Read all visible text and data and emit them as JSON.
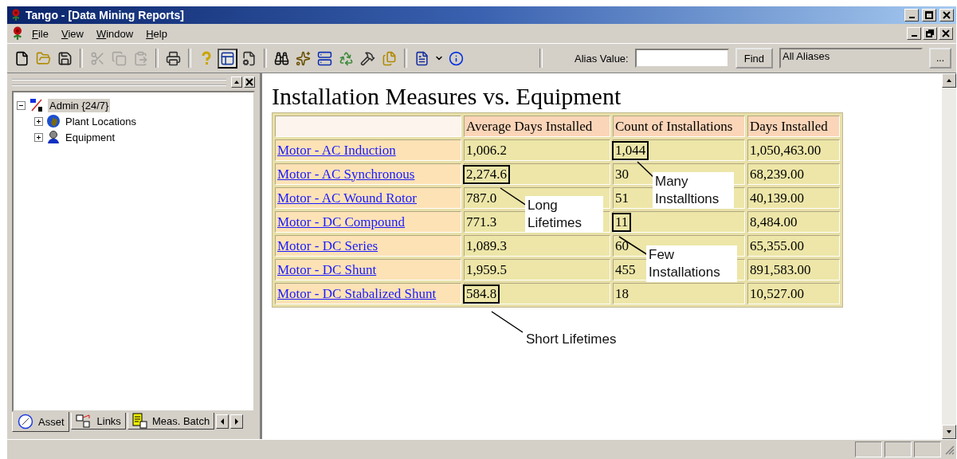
{
  "window": {
    "title": "Tango - [Data Mining Reports]"
  },
  "menu": [
    {
      "label": "File"
    },
    {
      "label": "View"
    },
    {
      "label": "Window"
    },
    {
      "label": "Help"
    }
  ],
  "toolbar": {
    "groups": [
      [
        {
          "disabled": false,
          "pressed": false
        },
        {
          "disabled": false,
          "pressed": false
        },
        {
          "disabled": false,
          "pressed": false
        }
      ],
      [
        {
          "disabled": true,
          "pressed": false
        },
        {
          "disabled": true,
          "pressed": false
        },
        {
          "disabled": true,
          "pressed": false
        }
      ],
      [
        {
          "disabled": false,
          "pressed": false
        }
      ],
      [
        {
          "disabled": false,
          "pressed": false
        },
        {
          "disabled": false,
          "pressed": true
        },
        {
          "disabled": false,
          "pressed": false
        }
      ],
      [
        {
          "disabled": false,
          "pressed": false
        },
        {
          "disabled": false,
          "pressed": false
        },
        {
          "disabled": false,
          "pressed": false
        },
        {
          "disabled": false,
          "pressed": false
        },
        {
          "disabled": false,
          "pressed": false
        },
        {
          "disabled": false,
          "pressed": false
        }
      ],
      [
        {
          "disabled": false,
          "pressed": false
        },
        {
          "disabled": false,
          "pressed": false
        },
        {
          "disabled": false,
          "pressed": false
        }
      ]
    ],
    "alias_label": "Alias Value:",
    "find_button": "Find",
    "alias_scope": "All Aliases",
    "browse_button": "..."
  },
  "tree": [
    {
      "label": "Admin {24/7}",
      "selected": true,
      "expanded": true,
      "children": [
        {
          "label": "Plant Locations",
          "selected": false,
          "expanded": false
        },
        {
          "label": "Equipment",
          "selected": false,
          "expanded": false
        }
      ]
    }
  ],
  "tabs": [
    {
      "label": "Asset",
      "selected": true
    },
    {
      "label": "Links",
      "selected": false
    },
    {
      "label": "Meas. Batch",
      "selected": false
    }
  ],
  "report": {
    "title": "Installation Measures vs. Equipment",
    "columns": [
      "Average Days Installed",
      "Count of Installations",
      "Days Installed"
    ],
    "rows": [
      {
        "label": "Motor - AC Induction",
        "cells": [
          {
            "text": "1,006.2",
            "highlighted": false
          },
          {
            "text": "1,044",
            "highlighted": true
          },
          {
            "text": "1,050,463.00",
            "highlighted": false
          }
        ]
      },
      {
        "label": "Motor - AC Synchronous",
        "cells": [
          {
            "text": "2,274.6",
            "highlighted": true
          },
          {
            "text": "30",
            "highlighted": false
          },
          {
            "text": "68,239.00",
            "highlighted": false
          }
        ]
      },
      {
        "label": "Motor - AC Wound Rotor",
        "cells": [
          {
            "text": "787.0",
            "highlighted": false
          },
          {
            "text": "51",
            "highlighted": false
          },
          {
            "text": "40,139.00",
            "highlighted": false
          }
        ]
      },
      {
        "label": "Motor - DC Compound",
        "cells": [
          {
            "text": "771.3",
            "highlighted": false
          },
          {
            "text": "11",
            "highlighted": true
          },
          {
            "text": "8,484.00",
            "highlighted": false
          }
        ]
      },
      {
        "label": "Motor - DC Series",
        "cells": [
          {
            "text": "1,089.3",
            "highlighted": false
          },
          {
            "text": "60",
            "highlighted": false
          },
          {
            "text": "65,355.00",
            "highlighted": false
          }
        ]
      },
      {
        "label": "Motor - DC Shunt",
        "cells": [
          {
            "text": "1,959.5",
            "highlighted": false
          },
          {
            "text": "455",
            "highlighted": false
          },
          {
            "text": "891,583.00",
            "highlighted": false
          }
        ]
      },
      {
        "label": "Motor - DC Stabalized Shunt",
        "cells": [
          {
            "text": "584.8",
            "highlighted": true
          },
          {
            "text": "18",
            "highlighted": false
          },
          {
            "text": "10,527.00",
            "highlighted": false
          }
        ]
      }
    ],
    "annotations": [
      {
        "text": "Many Installtions"
      },
      {
        "text": "Long Lifetimes"
      },
      {
        "text": "Few Installations"
      },
      {
        "text": "Short Lifetimes"
      }
    ]
  }
}
